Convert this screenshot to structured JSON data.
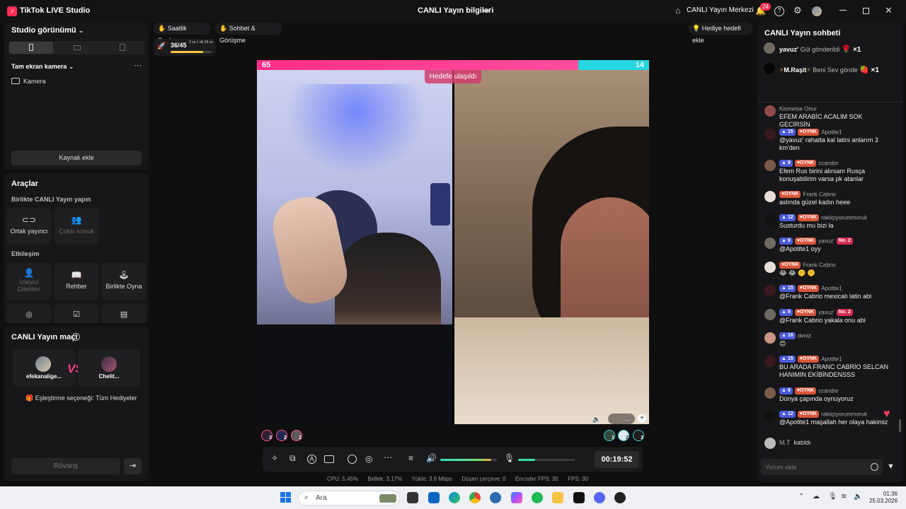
{
  "titlebar": {
    "app_title": "TikTok LIVE Studio",
    "center_title": "CANLI Yayın bilgileri",
    "live_center": "CANLI Yayın Merkezi",
    "notif_count": "24",
    "logo_glyph": "♪"
  },
  "left": {
    "studio_view": "Studio görünümü",
    "camera_section": "Tam ekran kamera",
    "camera_item": "Kamera",
    "add_source": "Kaynak ekle",
    "tools_title": "Araçlar",
    "together_title": "Birlikte CANLI Yayın yapın",
    "tools_together": [
      {
        "label": "Ortak yayıncı",
        "icon": "link-icon"
      },
      {
        "label": "Çoklu konuk",
        "icon": "users-icon"
      }
    ],
    "interaction_title": "Etkileşim",
    "tools_interaction": [
      {
        "label": "İzleyici Dilekleri",
        "icon": "people-icon"
      },
      {
        "label": "Rehber",
        "icon": "book-icon"
      },
      {
        "label": "Birlikte Oyna",
        "icon": "gamepad-icon"
      }
    ],
    "match_title": "CANLI Yayın maçı",
    "player1": "efekanalige...",
    "player2": "Chelit...",
    "vs": "VS",
    "match_option": "Eşleştirme seçeneği: Tüm Hediyeler",
    "rematch": "Rövanş"
  },
  "top": {
    "hourly_rank": "Saatlik Sıralama",
    "chat_meet": "Sohbet & Görüşme",
    "gift_goal": "Hediye hedefi ekle",
    "progress_label": "36/45",
    "progress_fraction": 0.8,
    "timer_small": "2 sa 1 dk 38 sn"
  },
  "battle": {
    "score_left": "65",
    "score_right": "14",
    "goal_banner": "Hedefe ulaşıldı",
    "left_fraction": 0.82,
    "color_left": "#ff2d8a",
    "color_right": "#27d6e0",
    "team_left_ranks": [
      "3",
      "2",
      "1"
    ],
    "team_right_ranks": [
      "1",
      "2",
      "3"
    ],
    "right_overlay": "…"
  },
  "controls": {
    "timer": "00:19:52",
    "volume_level": 0.9,
    "mic_level": 0.3
  },
  "stats": {
    "cpu": "CPU:  5.45%",
    "memory": "Bellek:  3.17%",
    "upload": "Yükle:  3.6 Mbps",
    "dropped": "Düşen çerçeve:  0",
    "encoder_fps": "Encoder FPS:  30",
    "fps": "FPS:  30"
  },
  "chat": {
    "title": "CANLI Yayın sohbeti",
    "gift1_user": "yavuz'",
    "gift1_text": "Gül gönderildi",
    "gift1_count": "×1",
    "gift2_user": "M.Raşit",
    "gift2_text": "Beni Sev gönde",
    "gift2_count": "×1",
    "messages": [
      {
        "level": "",
        "fan": "",
        "name": "Kismetse Onur",
        "text": "EFEM ARABİC ACALIM SOK GECİRSİN"
      },
      {
        "level": "15",
        "fan": "OYNK",
        "name": "Apotite1",
        "text": "@yavuz' rahatta kal latini anlarım 3 km'den"
      },
      {
        "level": "9",
        "fan": "OYNK",
        "name": "ccandor",
        "text": "Efem Rus birini alırsam Rusça konuşabilirim varsa pk atanlar"
      },
      {
        "level": "",
        "fan": "OYNK",
        "name": "Frank Cabrio",
        "text": "aslında güzel kadın heee"
      },
      {
        "level": "12",
        "fan": "OYNK",
        "name": "rakiiçiyorummoruk",
        "text": "Susturdu mu bizi la"
      },
      {
        "level": "9",
        "fan": "OYNK",
        "name": "yavuz'",
        "badge": "No. 2",
        "text": "@Apotite1 oyy"
      },
      {
        "level": "",
        "fan": "OYNK",
        "name": "Frank Cabrio",
        "text": "😂 😂 🤫 🤫"
      },
      {
        "level": "15",
        "fan": "OYNK",
        "name": "Apotite1",
        "text": "@Frank Cabrio mexicalı latin abi"
      },
      {
        "level": "9",
        "fan": "OYNK",
        "name": "yavuz'",
        "badge": "No. 2",
        "text": "@Frank Cabrio yakala onu abi"
      },
      {
        "level": "16",
        "fan": "",
        "name": "deniz",
        "text": "😊"
      },
      {
        "level": "15",
        "fan": "OYNK",
        "name": "Apotite1",
        "text": "BU ARADA FRANC CABRİO SELCAN HANIMIN EKİBİNDENSSS"
      },
      {
        "level": "9",
        "fan": "OYNK",
        "name": "ccandor",
        "text": "Dünya çapında oynuyoruz"
      },
      {
        "level": "12",
        "fan": "OYNK",
        "name": "rakiiçiyorummoruk",
        "text": "@Apotite1 maşallah her olaya hakimiz"
      }
    ],
    "joined_user": "M.T",
    "joined_text": "katıldı",
    "input_placeholder": "Yorum ekle"
  },
  "taskbar": {
    "search_placeholder": "Ara",
    "time": "01:36",
    "date": "25.03.2026"
  }
}
